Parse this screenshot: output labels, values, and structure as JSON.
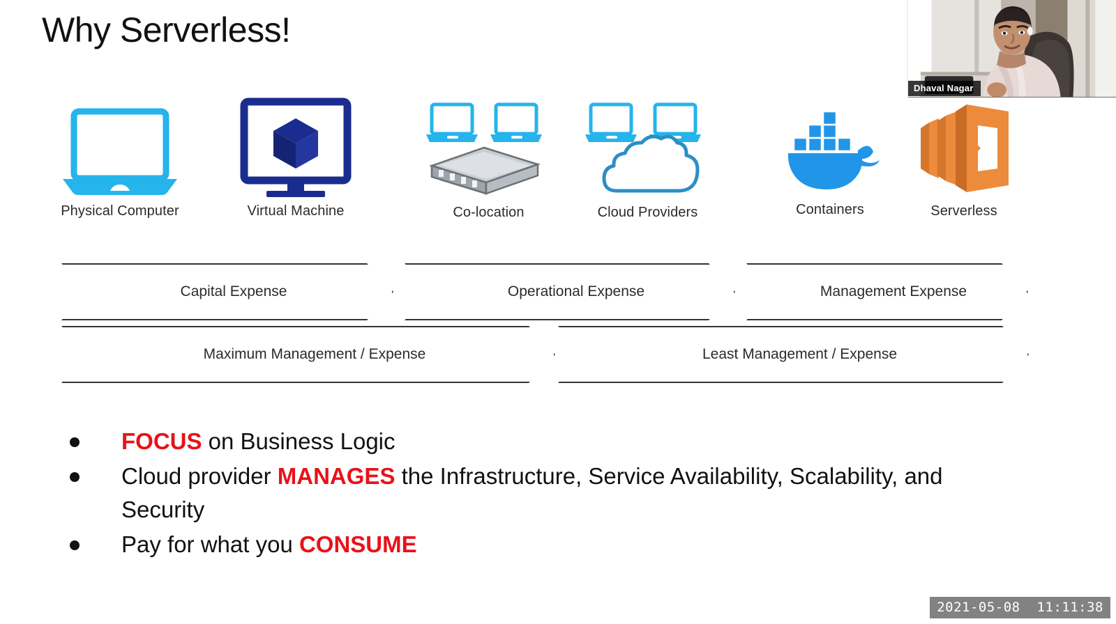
{
  "slide": {
    "title": "Why Serverless!"
  },
  "icon_row": [
    {
      "label": "Physical Computer",
      "icon": "laptop-icon",
      "color": "#25b4ec"
    },
    {
      "label": "Virtual Machine",
      "icon": "monitor-cube-icon",
      "color": "#1a2d8f"
    },
    {
      "label": "Co-location",
      "icon": "server-rack-icon",
      "color": "#a8adb4"
    },
    {
      "label": "Cloud Providers",
      "icon": "cloud-icon",
      "color": "#2b8fc4"
    },
    {
      "label": "Containers",
      "icon": "docker-whale-icon",
      "color": "#2196e8"
    },
    {
      "label": "Serverless",
      "icon": "aws-lambda-icon",
      "color": "#ed8b3c"
    }
  ],
  "chevrons": {
    "row1": [
      {
        "label": "Capital Expense"
      },
      {
        "label": "Operational Expense"
      },
      {
        "label": "Management Expense"
      }
    ],
    "row2": [
      {
        "label": "Maximum Management / Expense"
      },
      {
        "label": "Least Management / Expense"
      }
    ]
  },
  "bullets": [
    {
      "segments": [
        {
          "text": "FOCUS",
          "highlight": true
        },
        {
          "text": " on Business Logic",
          "highlight": false
        }
      ]
    },
    {
      "segments": [
        {
          "text": "Cloud provider ",
          "highlight": false
        },
        {
          "text": "MANAGES",
          "highlight": true
        },
        {
          "text": " the Infrastructure, Service Availability, Scalability, and Security",
          "highlight": false
        }
      ]
    },
    {
      "segments": [
        {
          "text": "Pay for what you ",
          "highlight": false
        },
        {
          "text": "CONSUME",
          "highlight": true
        }
      ]
    }
  ],
  "webcam": {
    "participant_name": "Dhaval Nagar"
  },
  "timestamp": {
    "value": "2021-05-08  11:11:38"
  },
  "colors": {
    "highlight_red": "#e8121a",
    "cyan": "#25b4ec",
    "navy": "#1a2d8f",
    "docker_blue": "#2196e8",
    "lambda_orange": "#ed8b3c",
    "chevron_stroke": "#333333",
    "timestamp_bg": "#828282"
  }
}
